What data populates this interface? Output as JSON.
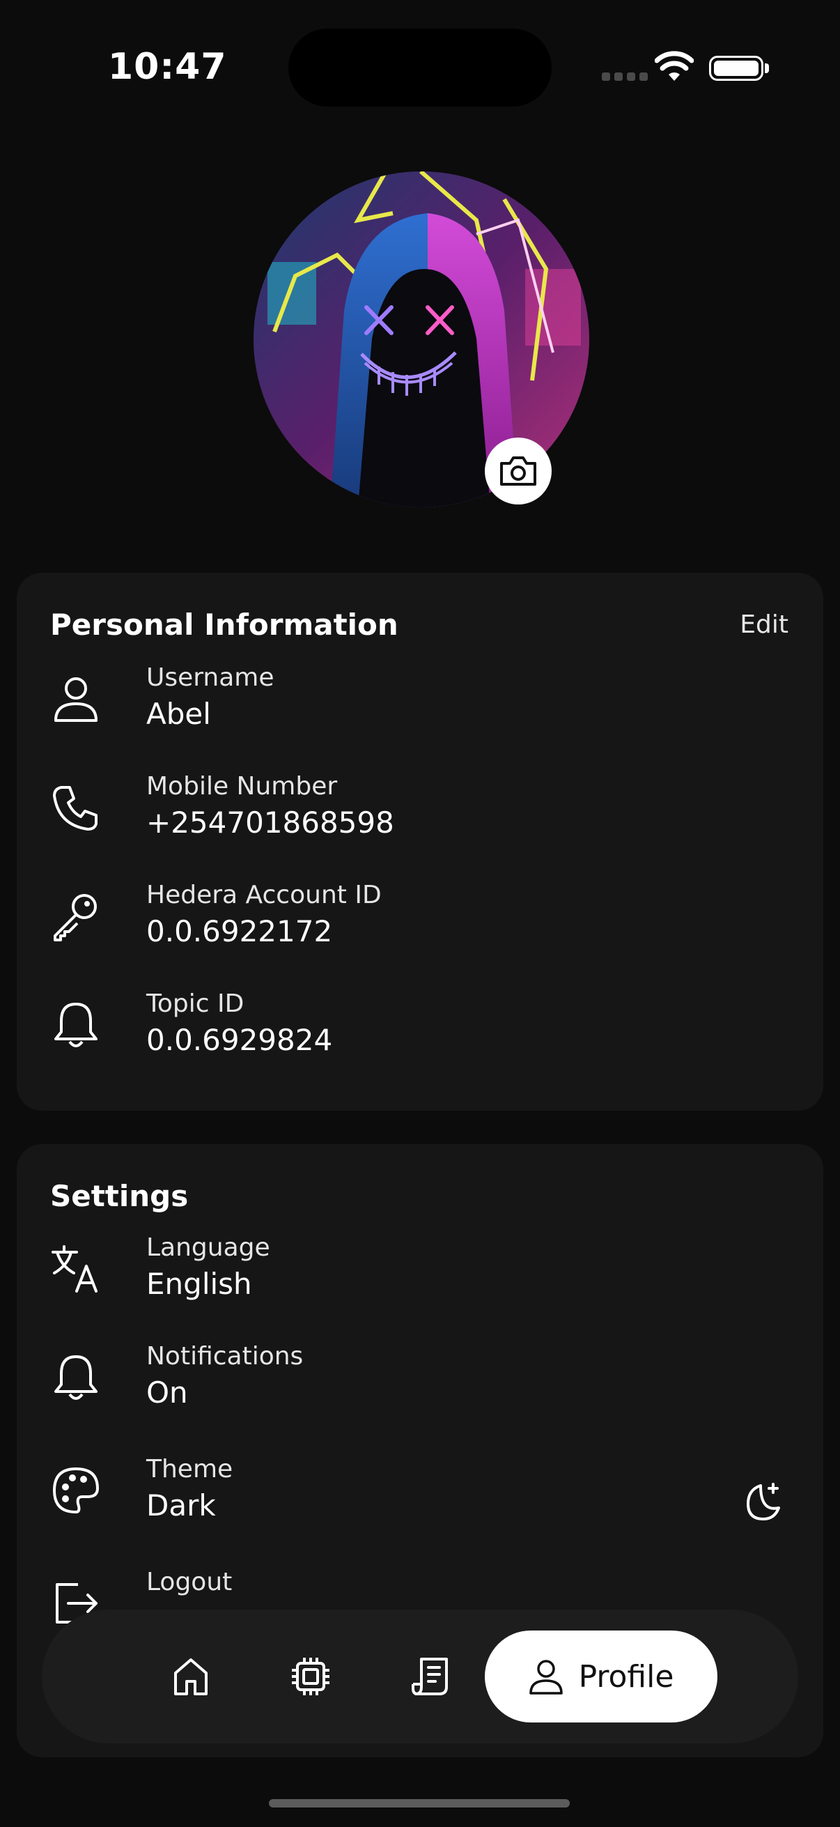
{
  "status": {
    "time": "10:47"
  },
  "profile": {
    "avatar": "hooded-neon-mask-avatar",
    "camera_icon": "camera-icon"
  },
  "personal": {
    "title": "Personal Information",
    "edit_label": "Edit",
    "items": [
      {
        "icon": "user-icon",
        "label": "Username",
        "value": "Abel"
      },
      {
        "icon": "phone-icon",
        "label": "Mobile Number",
        "value": "+254701868598"
      },
      {
        "icon": "key-icon",
        "label": "Hedera Account ID",
        "value": "0.0.6922172"
      },
      {
        "icon": "bell-icon",
        "label": "Topic ID",
        "value": "0.0.6929824"
      }
    ]
  },
  "settings": {
    "title": "Settings",
    "items": [
      {
        "icon": "translate-icon",
        "label": "Language",
        "value": "English"
      },
      {
        "icon": "bell-icon",
        "label": "Notifications",
        "value": "On"
      },
      {
        "icon": "palette-icon",
        "label": "Theme",
        "value": "Dark",
        "trailing_icon": "moon-icon"
      },
      {
        "icon": "logout-icon",
        "label": "Logout"
      }
    ]
  },
  "nav": {
    "items": [
      {
        "icon": "home-icon"
      },
      {
        "icon": "chip-icon"
      },
      {
        "icon": "receipt-icon"
      },
      {
        "icon": "user-icon",
        "label": "Profile",
        "active": true
      }
    ]
  },
  "colors": {
    "background": "#0c0c0c",
    "card": "#161616",
    "nav": "#1d1d1d",
    "active_pill": "#ffffff"
  }
}
